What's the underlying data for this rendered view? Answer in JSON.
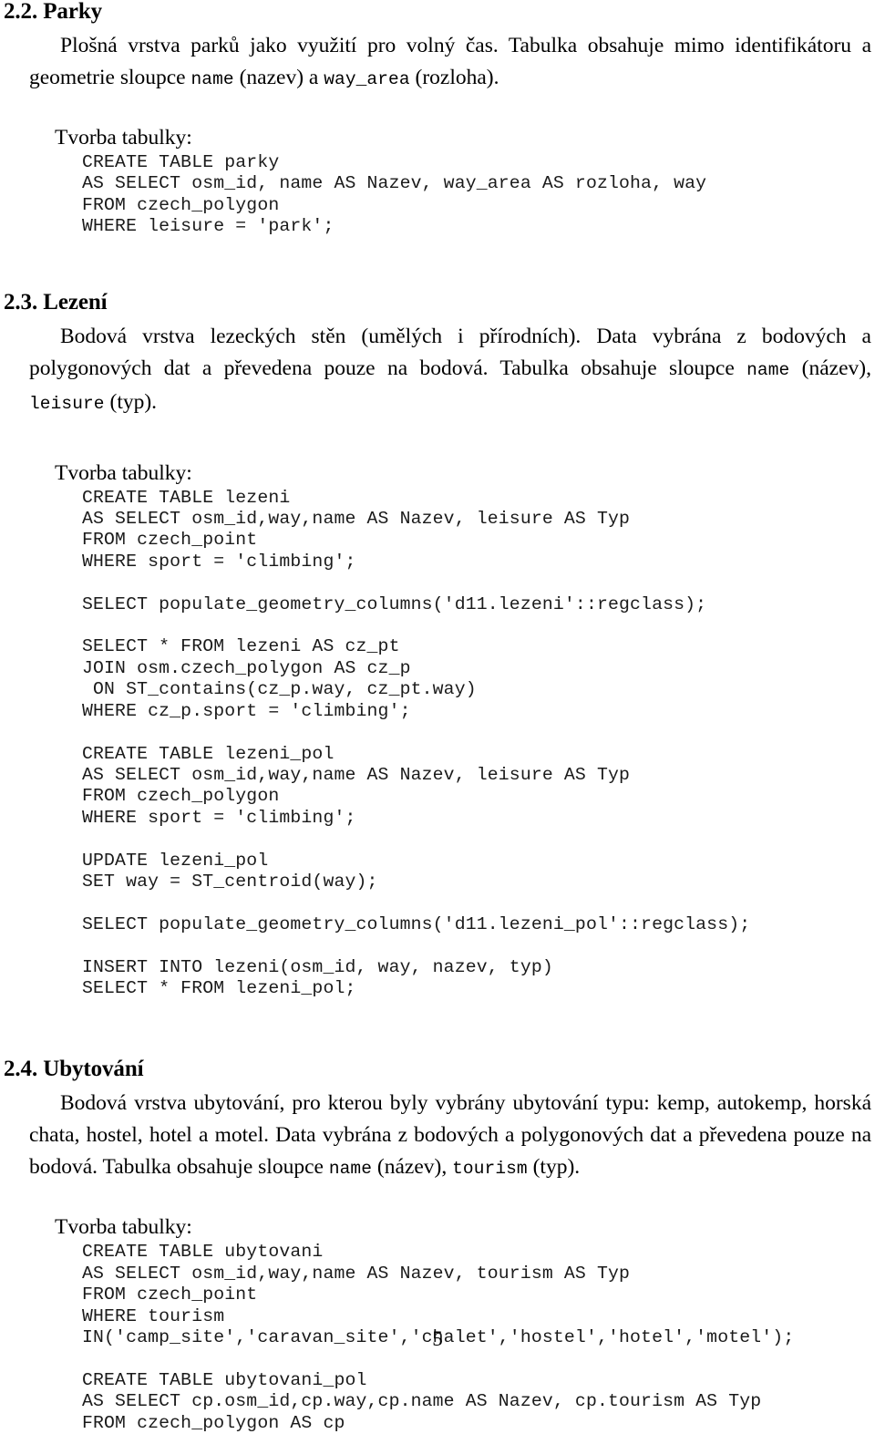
{
  "document": {
    "language": "cs",
    "page_number": "5",
    "text_color": "#000000",
    "code_color": "#1a1a1a",
    "background": "#ffffff"
  },
  "sections": [
    {
      "id": "parky",
      "heading": "2.2. Parky",
      "paragraphs": [
        {
          "parts": [
            {
              "type": "text",
              "value": "Plošná vrstva parků jako využití pro volný čas. Tabulka obsahuje mimo identifikátoru a geometrie sloupce "
            },
            {
              "type": "mono",
              "value": "name"
            },
            {
              "type": "text",
              "value": " (nazev) a "
            },
            {
              "type": "mono",
              "value": "way_area"
            },
            {
              "type": "text",
              "value": " (rozloha)."
            }
          ],
          "plain": "Plošná vrstva parků jako využití pro volný čas. Tabulka obsahuje mimo identifikátoru a geometrie sloupce name (nazev) a way_area (rozloha)."
        }
      ],
      "code_label": "Tvorba tabulky:",
      "code": "CREATE TABLE parky\nAS SELECT osm_id, name AS Nazev, way_area AS rozloha, way\nFROM czech_polygon\nWHERE leisure = 'park';"
    },
    {
      "id": "lezeni",
      "heading": "2.3. Lezení",
      "paragraphs": [
        {
          "parts": [
            {
              "type": "text",
              "value": "Bodová vrstva lezeckých stěn (umělých i přírodních). Data vybrána z bodových a polygonových dat a převedena pouze na bodová. Tabulka obsahuje sloupce "
            },
            {
              "type": "mono",
              "value": "name"
            },
            {
              "type": "text",
              "value": " (název), "
            },
            {
              "type": "mono",
              "value": "leisure"
            },
            {
              "type": "text",
              "value": " (typ)."
            }
          ],
          "plain": "Bodová vrstva lezeckých stěn (umělých i přírodních). Data vybrána z bodových a polygonových dat a převedena pouze na bodová. Tabulka obsahuje sloupce name (název), leisure (typ)."
        }
      ],
      "code_label": "Tvorba tabulky:",
      "code": "CREATE TABLE lezeni\nAS SELECT osm_id,way,name AS Nazev, leisure AS Typ\nFROM czech_point\nWHERE sport = 'climbing';\n\nSELECT populate_geometry_columns('d11.lezeni'::regclass);\n\nSELECT * FROM lezeni AS cz_pt\nJOIN osm.czech_polygon AS cz_p\n ON ST_contains(cz_p.way, cz_pt.way)\nWHERE cz_p.sport = 'climbing';\n\nCREATE TABLE lezeni_pol\nAS SELECT osm_id,way,name AS Nazev, leisure AS Typ\nFROM czech_polygon\nWHERE sport = 'climbing';\n\nUPDATE lezeni_pol\nSET way = ST_centroid(way);\n\nSELECT populate_geometry_columns('d11.lezeni_pol'::regclass);\n\nINSERT INTO lezeni(osm_id, way, nazev, typ)\nSELECT * FROM lezeni_pol;"
    },
    {
      "id": "ubytovani",
      "heading": "2.4. Ubytování",
      "paragraphs": [
        {
          "parts": [
            {
              "type": "text",
              "value": "Bodová vrstva ubytování, pro kterou byly vybrány ubytování typu: kemp, autokemp, horská chata, hostel, hotel a motel. Data vybrána z bodových a polygonových dat a převedena pouze na bodová. Tabulka obsahuje sloupce "
            },
            {
              "type": "mono",
              "value": "name"
            },
            {
              "type": "text",
              "value": " (název), "
            },
            {
              "type": "mono",
              "value": "tourism"
            },
            {
              "type": "text",
              "value": " (typ)."
            }
          ],
          "plain": "Bodová vrstva ubytování, pro kterou byly vybrány ubytování typu: kemp, autokemp, horská chata, hostel, hotel a motel. Data vybrána z bodových a polygonových dat a převedena pouze na bodová. Tabulka obsahuje sloupce name (název), tourism (typ)."
        }
      ],
      "code_label": "Tvorba tabulky:",
      "code": "CREATE TABLE ubytovani\nAS SELECT osm_id,way,name AS Nazev, tourism AS Typ\nFROM czech_point\nWHERE tourism\nIN('camp_site','caravan_site','chalet','hostel','hotel','motel');\n\nCREATE TABLE ubytovani_pol\nAS SELECT cp.osm_id,cp.way,cp.name AS Nazev, cp.tourism AS Typ\nFROM czech_polygon AS cp"
    }
  ]
}
